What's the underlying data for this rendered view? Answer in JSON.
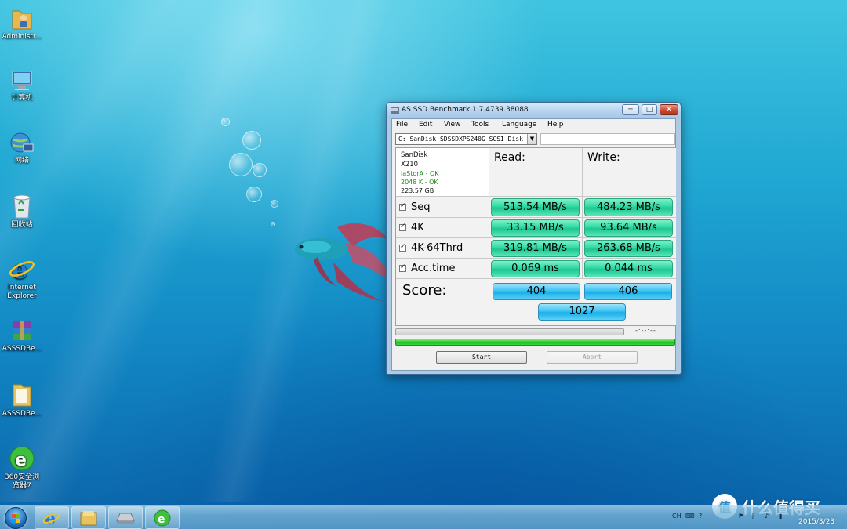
{
  "desktop": {
    "icons": [
      {
        "label": "Administr...",
        "icon": "user-folder-icon"
      },
      {
        "label": "计算机",
        "icon": "computer-icon"
      },
      {
        "label": "网络",
        "icon": "network-icon"
      },
      {
        "label": "回收站",
        "icon": "recycle-bin-icon"
      },
      {
        "label": "Internet Explorer",
        "icon": "internet-explorer-icon"
      },
      {
        "label": "ASSSDBe...",
        "icon": "winrar-archive-icon"
      },
      {
        "label": "ASSSDBe...",
        "icon": "folder-icon"
      },
      {
        "label": "360安全浏览器7",
        "icon": "browser-360-icon"
      }
    ]
  },
  "window": {
    "title": "AS SSD Benchmark 1.7.4739.38088",
    "controls": {
      "minimize": "─",
      "maximize": "□",
      "close": "✕"
    },
    "menu": [
      "File",
      "Edit",
      "View",
      "Tools",
      "Language",
      "Help"
    ],
    "drive_select": "C: SanDisk SDSSDXPS240G SCSI Disk De",
    "drive_info": {
      "vendor": "SanDisk",
      "model": "X210",
      "driver": "iaStorA - OK",
      "alignment": "2048 K - OK",
      "size": "223.57 GB"
    },
    "headers": {
      "read": "Read:",
      "write": "Write:"
    },
    "rows": [
      {
        "label": "Seq",
        "read": "513.54 MB/s",
        "write": "484.23 MB/s",
        "checked": true
      },
      {
        "label": "4K",
        "read": "33.15 MB/s",
        "write": "93.64 MB/s",
        "checked": true
      },
      {
        "label": "4K-64Thrd",
        "read": "319.81 MB/s",
        "write": "263.68 MB/s",
        "checked": true
      },
      {
        "label": "Acc.time",
        "read": "0.069 ms",
        "write": "0.044 ms",
        "checked": true
      }
    ],
    "score": {
      "label": "Score:",
      "read": "404",
      "write": "406",
      "total": "1027"
    },
    "elapsed": "-:--:--",
    "buttons": {
      "start": "Start",
      "abort": "Abort"
    }
  },
  "taskbar": {
    "pinned": [
      "internet-explorer-icon",
      "file-explorer-icon",
      "drive-icon",
      "browser-360-icon"
    ],
    "tray": {
      "language": "CH",
      "icons": [
        "keyboard-icon",
        "help-icon",
        "flag-icon",
        "bluetooth-icon",
        "volume-icon",
        "network-icon"
      ]
    },
    "date": "2015/3/23"
  },
  "watermark": {
    "text": "什么值得买",
    "logo": "值"
  },
  "colors": {
    "accent_green": "#2fd9a4",
    "accent_blue": "#19aee6",
    "progress_green": "#1fc11f"
  }
}
